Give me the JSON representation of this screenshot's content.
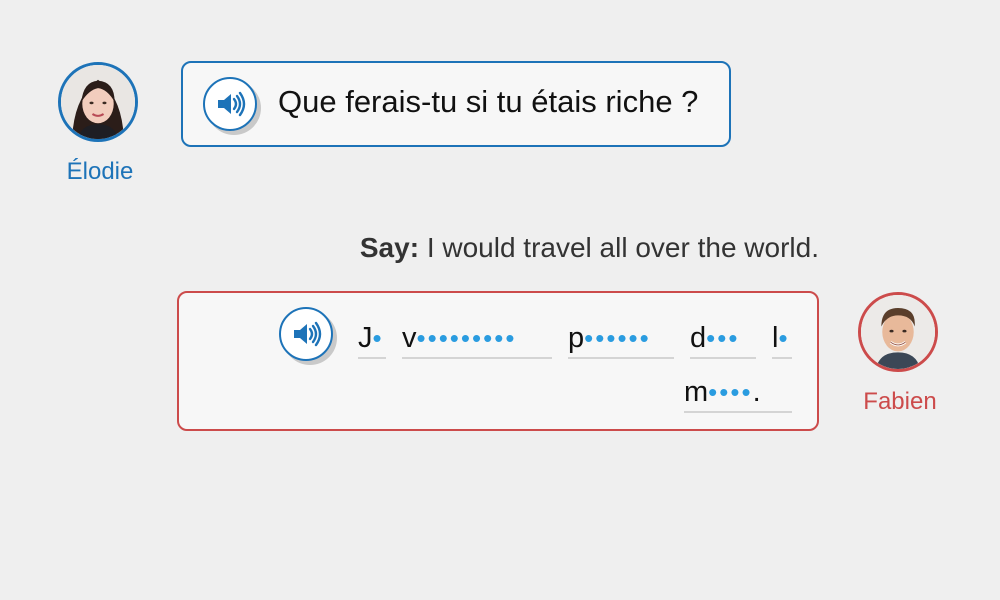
{
  "conversation": {
    "elodie": {
      "name": "Élodie",
      "color": "#1d73b8",
      "avatar_icon": "woman-portrait",
      "message": "Que ferais-tu si tu étais riche ?"
    },
    "prompt": {
      "label": "Say:",
      "text": "I would travel all over the world."
    },
    "fabien": {
      "name": "Fabien",
      "color": "#cc4b4b",
      "avatar_icon": "man-portrait",
      "answer_words": [
        {
          "first": "J",
          "hint": "•"
        },
        {
          "first": "v",
          "hint": "•••••••••"
        },
        {
          "first": "p",
          "hint": "••••••"
        },
        {
          "first": "d",
          "hint": "•••"
        },
        {
          "first": "l",
          "hint": "•"
        },
        {
          "first": "m",
          "hint": "••••",
          "punct": "."
        }
      ]
    },
    "audio_icon": "speaker-icon",
    "hint_dot_color": "#2a9ce0"
  }
}
